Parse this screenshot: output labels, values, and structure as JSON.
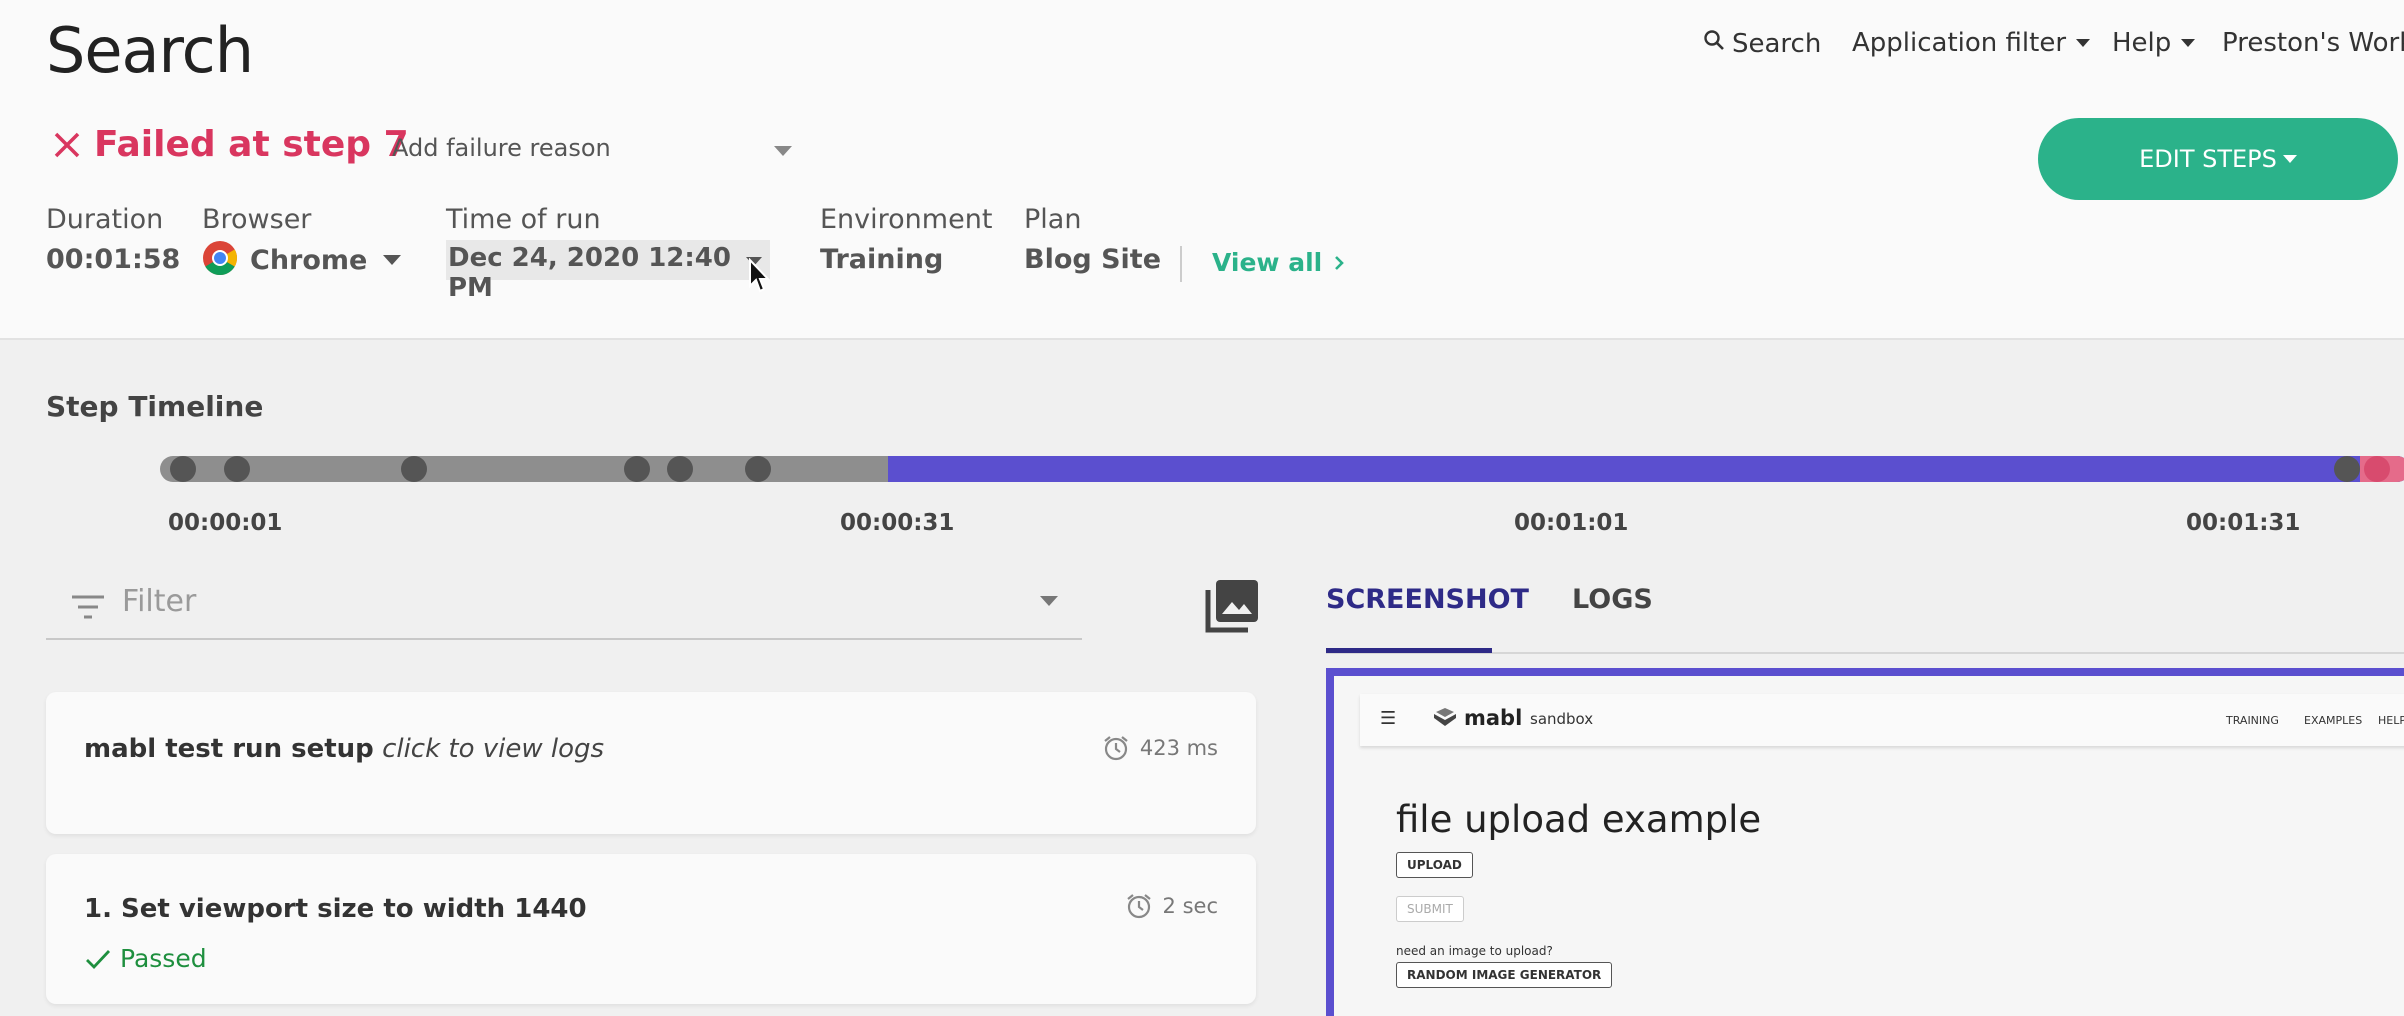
{
  "header": {
    "title": "Search",
    "nav": {
      "search_label": "Search",
      "application_filter": "Application filter",
      "help": "Help",
      "workspace": "Preston's Work"
    },
    "status": "Failed at step 7",
    "failure_reason_placeholder": "Add failure reason",
    "edit_steps": "EDIT STEPS",
    "meta": {
      "duration_label": "Duration",
      "duration": "00:01:58",
      "browser_label": "Browser",
      "browser": "Chrome",
      "time_label": "Time of run",
      "time": "Dec 24, 2020 12:40 PM",
      "environment_label": "Environment",
      "environment": "Training",
      "plan_label": "Plan",
      "plan": "Blog Site",
      "view_all": "View all"
    }
  },
  "timeline": {
    "title": "Step Timeline",
    "ticks": [
      "00:00:01",
      "00:00:31",
      "00:01:01",
      "00:01:31"
    ]
  },
  "filter": {
    "placeholder": "Filter"
  },
  "steps": [
    {
      "title": "mabl test run setup",
      "hint": "click to view logs",
      "duration": "423 ms"
    },
    {
      "title": "1. Set viewport size to width 1440",
      "status": "Passed",
      "duration": "2 sec"
    }
  ],
  "tabs": [
    "SCREENSHOT",
    "LOGS"
  ],
  "preview": {
    "brand": "mabl",
    "sandbox": "sandbox",
    "nav": [
      "TRAINING",
      "EXAMPLES",
      "HELP"
    ],
    "heading": "file upload example",
    "upload": "UPLOAD",
    "submit": "SUBMIT",
    "prompt": "need an image to upload?",
    "random": "RANDOM IMAGE GENERATOR"
  },
  "colors": {
    "accent": "#2bb28a",
    "fail": "#d9365f",
    "timeline_blue": "#5b4fcf",
    "tab_active": "#2e2a87"
  }
}
